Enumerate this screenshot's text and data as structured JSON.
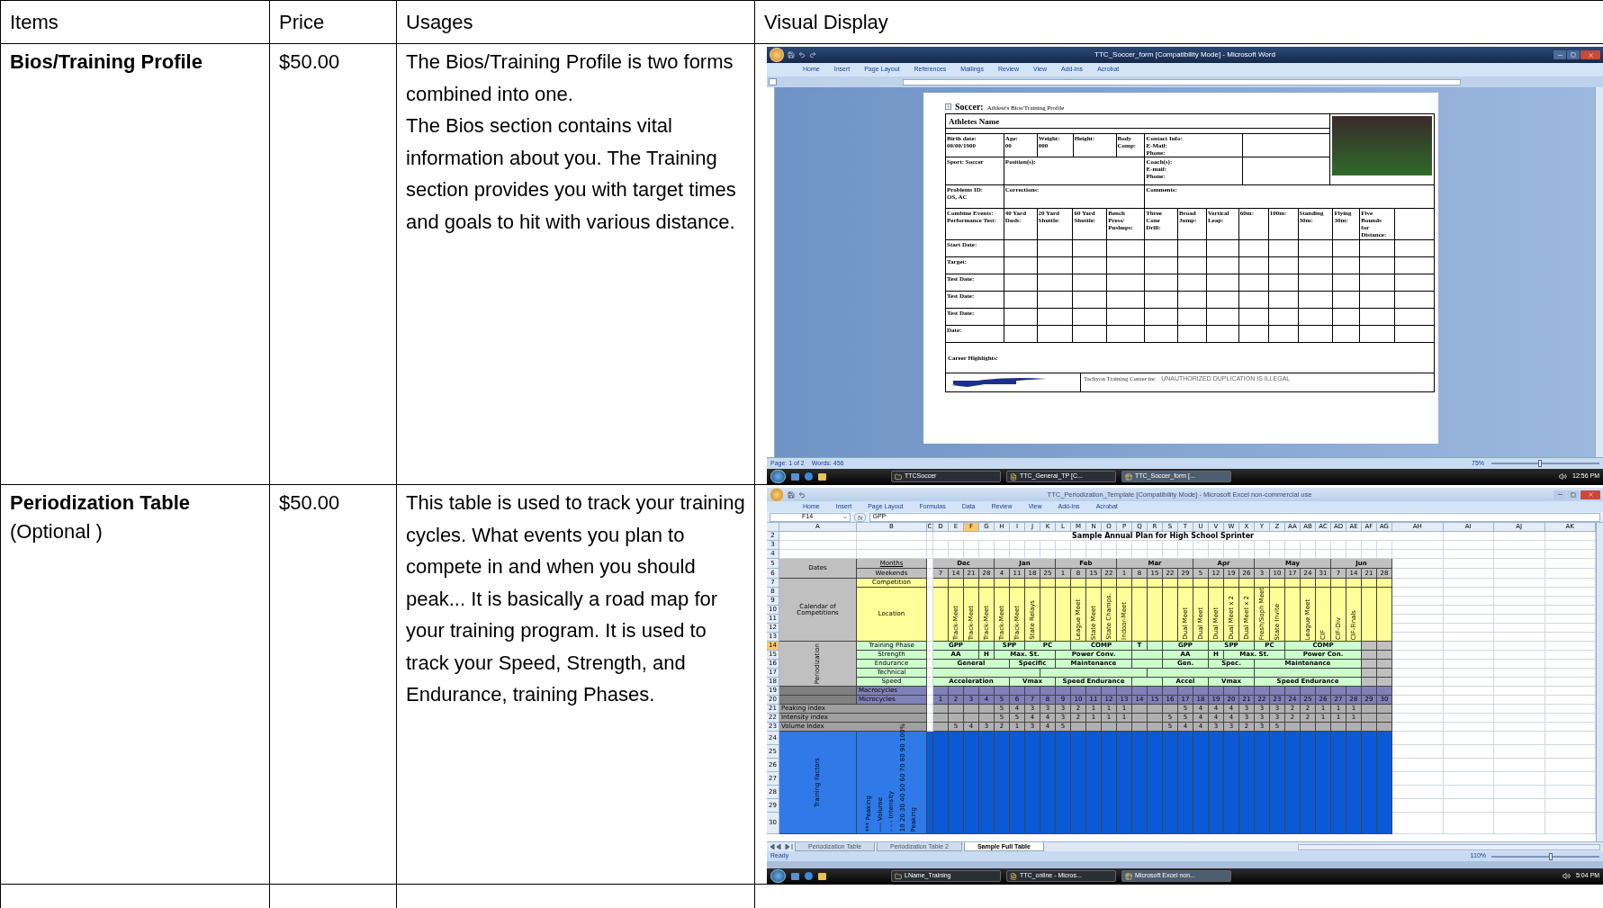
{
  "table": {
    "columns": [
      "Items",
      "Price",
      "Usages",
      "Visual Display"
    ],
    "rows": [
      {
        "item": "Bios/Training Profile",
        "price": "$50.00",
        "usage": [
          "The Bios/Training Profile is two forms combined into one.",
          "The Bios section contains vital information about you.  The Training section provides you with target times and goals to hit with various distance."
        ],
        "visual": {
          "kind": "word",
          "title": "TTC_Soccer_form [Compatibility Mode] - Microsoft Word",
          "ribbon_tabs": [
            "Home",
            "Insert",
            "Page Layout",
            "References",
            "Mailings",
            "Review",
            "View",
            "Add-Ins",
            "Acrobat"
          ],
          "document": {
            "heading": "Soccer:",
            "subheading": "Athlete's Bios/Training Profile",
            "name_label": "Athletes Name",
            "info_rows": [
              [
                "Birth date:\n00/00/1900",
                "Age:\n00",
                "Weight:\n000",
                "Height:",
                "Body\nComp:",
                "Contact Info:\nE-Mail:\nPhone:"
              ],
              [
                "Sport: Soccer",
                "Position(s):",
                "Coach(s):\nE-mail:\nPhone:"
              ],
              [
                "Problems ID:\nOS, AC",
                "Corrections:",
                "Comments:"
              ]
            ],
            "test_header": [
              "Combine Events:\nPerformance Test:",
              "40 Yard\nDash:",
              "20 Yard\nShuttle:",
              "60 Yard\nShuttle:",
              "Bench\nPress/\nPushups:",
              "Three\nCone\nDrill:",
              "Broad\nJump:",
              "Vertical\nLeap:",
              "60m:",
              "100m:",
              "Standing\n30m:",
              "Flying\n30m:",
              "Five\nBounds\nfor\nDistance:"
            ],
            "test_rows": [
              "Start Date:",
              "Target:",
              "Test Date:",
              "Test Date:",
              "Test Date:",
              "Date:"
            ],
            "career_label": "Career Highlights:",
            "footer_company": "Tachyon Training Center inc",
            "footer_notice": "UNAUTHORIZED DUPLICATION IS ILLEGAL"
          },
          "status": [
            "Page: 1 of 2",
            "Words: 456"
          ],
          "zoom": "75%",
          "zoom_slider": {
            "level": 0.45
          },
          "taskbar": {
            "items": [
              {
                "label": "TTCSoccer",
                "selected": false
              },
              {
                "label": "TTC_General_TP [C...",
                "selected": false
              },
              {
                "label": "TTC_Soccer_form [...",
                "selected": true
              }
            ],
            "time": "12:56 PM"
          }
        }
      },
      {
        "item": "Periodization Table",
        "item_note": "(Optional )",
        "price": "$50.00",
        "usage": [
          "This table is used to track your training cycles. What events you plan to compete in and when you should peak... It is basically a road map for your training program. It is used to track your Speed, Strength, and Endurance, training Phases."
        ],
        "visual": {
          "kind": "excel",
          "title": "TTC_Periodization_Template [Compatibility Mode] - Microsoft Excel non-commercial use",
          "ribbon_tabs": [
            "Home",
            "Insert",
            "Page Layout",
            "Formulas",
            "Data",
            "Review",
            "View",
            "Add-Ins",
            "Acrobat"
          ],
          "name_box": "F14",
          "function_label": "fx",
          "formula": "GPP",
          "columns": [
            {
              "label": "A",
              "selected": false
            },
            {
              "label": "B",
              "selected": false
            },
            {
              "label": "C",
              "selected": false
            },
            {
              "label": "D",
              "selected": false
            },
            {
              "label": "E",
              "selected": false
            },
            {
              "label": "F",
              "selected": true
            },
            {
              "label": "G",
              "selected": false
            },
            {
              "label": "H",
              "selected": false
            },
            {
              "label": "I",
              "selected": false
            },
            {
              "label": "J",
              "selected": false
            },
            {
              "label": "K",
              "selected": false
            },
            {
              "label": "L",
              "selected": false
            },
            {
              "label": "M",
              "selected": false
            },
            {
              "label": "N",
              "selected": false
            },
            {
              "label": "O",
              "selected": false
            },
            {
              "label": "P",
              "selected": false
            },
            {
              "label": "Q",
              "selected": false
            },
            {
              "label": "R",
              "selected": false
            },
            {
              "label": "S",
              "selected": false
            },
            {
              "label": "T",
              "selected": false
            },
            {
              "label": "U",
              "selected": false
            },
            {
              "label": "V",
              "selected": false
            },
            {
              "label": "W",
              "selected": false
            },
            {
              "label": "X",
              "selected": false
            },
            {
              "label": "Y",
              "selected": false
            },
            {
              "label": "Z",
              "selected": false
            },
            {
              "label": "AA",
              "selected": false
            },
            {
              "label": "AB",
              "selected": false
            },
            {
              "label": "AC",
              "selected": false
            },
            {
              "label": "AD",
              "selected": false
            },
            {
              "label": "AE",
              "selected": false
            },
            {
              "label": "AF",
              "selected": false
            },
            {
              "label": "AG",
              "selected": false
            },
            {
              "label": "AH",
              "selected": false
            },
            {
              "label": "AI",
              "selected": false
            },
            {
              "label": "AJ",
              "selected": false
            },
            {
              "label": "AK",
              "selected": false
            }
          ],
          "row_numbers": [
            {
              "label": "2",
              "selected": false
            },
            {
              "label": "3",
              "selected": false
            },
            {
              "label": "4",
              "selected": false
            },
            {
              "label": "5",
              "selected": false
            },
            {
              "label": "6",
              "selected": false
            },
            {
              "label": "7",
              "selected": false
            },
            {
              "label": "8",
              "selected": false
            },
            {
              "label": "9",
              "selected": false
            },
            {
              "label": "10",
              "selected": false
            },
            {
              "label": "11",
              "selected": false
            },
            {
              "label": "12",
              "selected": false
            },
            {
              "label": "13",
              "selected": false
            },
            {
              "label": "14",
              "selected": true
            },
            {
              "label": "15",
              "selected": false
            },
            {
              "label": "16",
              "selected": false
            },
            {
              "label": "17",
              "selected": false
            },
            {
              "label": "18",
              "selected": false
            },
            {
              "label": "19",
              "selected": false
            },
            {
              "label": "20",
              "selected": false
            },
            {
              "label": "21",
              "selected": false
            },
            {
              "label": "22",
              "selected": false
            },
            {
              "label": "23",
              "selected": false
            },
            {
              "label": "24",
              "selected": false
            },
            {
              "label": "25",
              "selected": false
            },
            {
              "label": "26",
              "selected": false
            },
            {
              "label": "27",
              "selected": false
            },
            {
              "label": "28",
              "selected": false
            },
            {
              "label": "29",
              "selected": false
            },
            {
              "label": "30",
              "selected": false
            }
          ],
          "sheet": {
            "title": "Sample Annual Plan for High School Sprinter",
            "dates_label": "Dates",
            "months_label": "Months",
            "months": [
              "Dec",
              "Jan",
              "Feb",
              "Mar",
              "Apr",
              "May",
              "Jun"
            ],
            "weekends_label": "Weekends",
            "weekends": [
              "7",
              "14",
              "21",
              "28",
              "4",
              "11",
              "18",
              "25",
              "1",
              "8",
              "15",
              "22",
              "1",
              "8",
              "15",
              "22",
              "29",
              "5",
              "12",
              "19",
              "26",
              "3",
              "10",
              "17",
              "24",
              "31",
              "7",
              "14",
              "21",
              "28"
            ],
            "competition_label": "Competition",
            "calendar_label": "Calendar of Competitions",
            "location_label": "Location",
            "locations": [
              "Track-Meet",
              "Track-Meet",
              "Track-Meet",
              "Track-Meet",
              "Track-Meet",
              "State Relays",
              "League Meet",
              "State Meet",
              "State Champs.",
              "Indoor-Meet",
              "Dual Meet",
              "Dual Meet",
              "Dual Meet",
              "Dual Meet x 2",
              "Dual Meet x 2",
              "Fresh/Soph Meet",
              "State Invite",
              "League Meet",
              "CIF",
              "CIF-Div",
              "CIF-Finals"
            ],
            "periodization_label": "Periodization",
            "phase_rows": [
              {
                "label": "Training Phase",
                "segments": [
                  "GPP",
                  "SPP",
                  "PC",
                  "COMP",
                  "T",
                  "GPP",
                  "SPP",
                  "PC",
                  "COMP"
                ]
              },
              {
                "label": "Strength",
                "segments": [
                  "AA",
                  "H",
                  "Max. St.",
                  "Power Conv.",
                  "AA",
                  "H",
                  "Max. St.",
                  "Power Con."
                ]
              },
              {
                "label": "Endurance",
                "segments": [
                  "General",
                  "Specific",
                  "Maintenance",
                  "Gen.",
                  "Spec.",
                  "Maintenance"
                ]
              },
              {
                "label": "Technical"
              },
              {
                "label": "Speed",
                "segments": [
                  "Acceleration",
                  "Vmax",
                  "Speed Endurance",
                  "Accel",
                  "Vmax",
                  "Speed Endurance"
                ]
              }
            ],
            "macrocycles_label": "Macrocycles",
            "microcycles_label": "Microcycles",
            "microcycles": [
              "1",
              "2",
              "3",
              "4",
              "5",
              "6",
              "7",
              "8",
              "9",
              "10",
              "11",
              "12",
              "13",
              "14",
              "15",
              "16",
              "17",
              "18",
              "19",
              "20",
              "21",
              "22",
              "23",
              "24",
              "25",
              "26",
              "27",
              "28",
              "29",
              "30"
            ],
            "index_rows": [
              {
                "label": "Peaking index",
                "values": [
                  "5",
                  "4",
                  "3",
                  "3",
                  "3",
                  "2",
                  "1",
                  "1",
                  "1",
                  "5",
                  "4",
                  "4",
                  "4",
                  "3",
                  "3",
                  "3",
                  "2",
                  "2",
                  "1",
                  "1",
                  "1"
                ]
              },
              {
                "label": "Intensity index",
                "values": [
                  "5",
                  "5",
                  "4",
                  "4",
                  "3",
                  "2",
                  "1",
                  "1",
                  "1",
                  "5",
                  "5",
                  "4",
                  "4",
                  "4",
                  "3",
                  "3",
                  "3",
                  "2",
                  "2",
                  "1",
                  "1",
                  "1"
                ]
              },
              {
                "label": "Volume Index",
                "values": [
                  "5",
                  "4",
                  "3",
                  "2",
                  "1",
                  "3",
                  "4",
                  "5",
                  "5",
                  "4",
                  "4",
                  "3",
                  "3",
                  "2",
                  "3",
                  "5"
                ]
              }
            ],
            "factors_label": "Training Factors",
            "legend": [
              "*** Peaking",
              "---- Volume",
              "- - - Intensity",
              "10 20 30 40 50 60 70 80 90 100%",
              "Peaking"
            ]
          },
          "sheet_tabs": [
            {
              "label": "Periodization Table",
              "selected": false
            },
            {
              "label": "Periodization Table 2",
              "selected": false
            },
            {
              "label": "Sample Full Table",
              "selected": true
            }
          ],
          "status": [
            "Ready"
          ],
          "zoom": "110%",
          "zoom_slider": {
            "level": 0.55
          },
          "taskbar": {
            "items": [
              {
                "label": "LName_Training",
                "selected": false
              },
              {
                "label": "TTC_online - Micros...",
                "selected": false
              },
              {
                "label": "Microsoft Excel non...",
                "selected": true
              }
            ],
            "time": "5:04 PM"
          }
        }
      }
    ]
  }
}
